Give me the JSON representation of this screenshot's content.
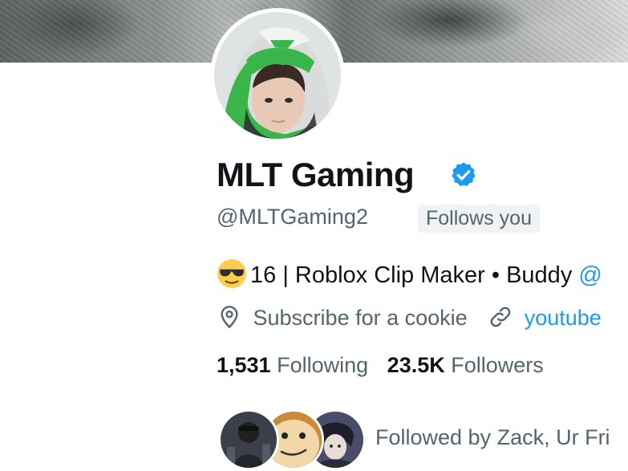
{
  "profile": {
    "name": "MLT Gaming",
    "handle": "@MLTGaming2",
    "follows_you": "Follows you",
    "verified": true,
    "bio": {
      "emoji": "smiling-face-with-sunglasses",
      "text": "16 | Roblox Clip Maker • Buddy",
      "mention_fragment": "@"
    },
    "location": "Subscribe for a cookie",
    "website": "youtube",
    "following_count": "1,531",
    "following_label": "Following",
    "followers_count": "23.5K",
    "followers_label": "Followers",
    "followed_by": "Followed by Zack, Ur Fri"
  },
  "colors": {
    "text_primary": "#0f1419",
    "text_secondary": "#536471",
    "accent": "#1d9bf0",
    "badge_bg": "#eff3f4"
  }
}
